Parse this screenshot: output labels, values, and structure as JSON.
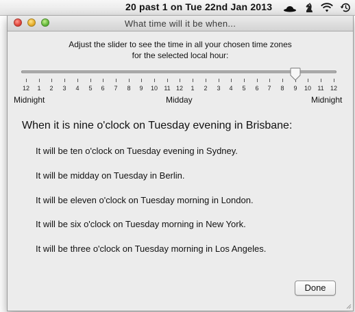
{
  "menubar": {
    "clock": "20 past 1 on Tue 22nd Jan 2013",
    "icons": [
      "bowler-hat-icon",
      "chess-knight-icon",
      "wifi-icon",
      "time-machine-icon"
    ]
  },
  "window": {
    "title": "What time will it be when..."
  },
  "instructions": {
    "line1": "Adjust the slider to see the time in all your chosen time zones",
    "line2": "for the selected local hour:"
  },
  "slider": {
    "selected_index": 21,
    "tick_labels": [
      "12",
      "1",
      "2",
      "3",
      "4",
      "5",
      "6",
      "7",
      "8",
      "9",
      "10",
      "11",
      "12",
      "1",
      "2",
      "3",
      "4",
      "5",
      "6",
      "7",
      "8",
      "9",
      "10",
      "11",
      "12"
    ],
    "left_label": "Midnight",
    "middle_label": "Midday",
    "right_label": "Midnight"
  },
  "heading": "When it is nine o'clock on Tuesday evening in Brisbane:",
  "results": [
    "It will be ten o'clock on Tuesday evening in Sydney.",
    "It will be midday on Tuesday in Berlin.",
    "It will be eleven o'clock on Tuesday morning in London.",
    "It will be six o'clock on Tuesday morning in New York.",
    "It will be three o'clock on Tuesday morning in Los Angeles."
  ],
  "done_label": "Done"
}
